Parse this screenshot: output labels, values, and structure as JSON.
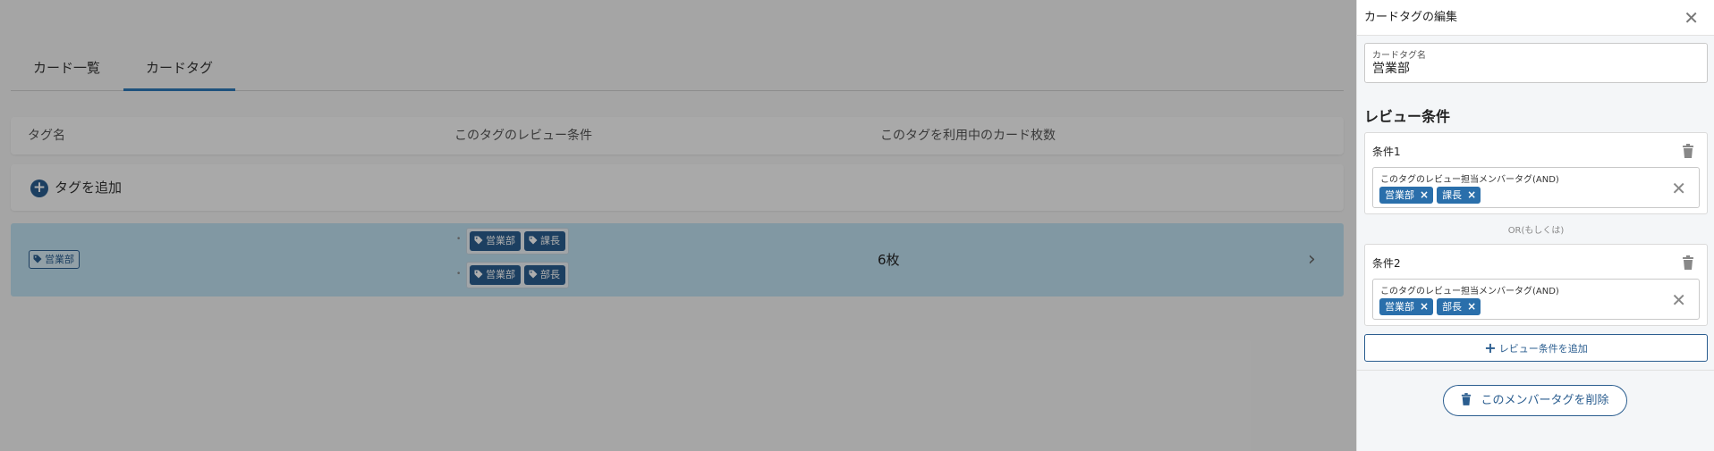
{
  "tabs": [
    {
      "label": "カード一覧"
    },
    {
      "label": "カードタグ"
    }
  ],
  "table": {
    "headers": [
      "タグ名",
      "このタグのレビュー条件",
      "このタグを利用中のカード枚数"
    ],
    "add_label": "タグを追加",
    "row": {
      "tag": "営業部",
      "conditions": [
        [
          "営業部",
          "課長"
        ],
        [
          "営業部",
          "部長"
        ]
      ],
      "count": "6枚"
    }
  },
  "panel": {
    "title": "カードタグの編集",
    "name_label": "カードタグ名",
    "name_value": "営業部",
    "section_title": "レビュー条件",
    "conditions": [
      {
        "title": "条件1",
        "member_label": "このタグのレビュー担当メンバータグ(AND)",
        "chips": [
          "営業部",
          "課長"
        ]
      },
      {
        "title": "条件2",
        "member_label": "このタグのレビュー担当メンバータグ(AND)",
        "chips": [
          "営業部",
          "部長"
        ]
      }
    ],
    "or_text": "OR(もしくは)",
    "add_condition_label": "レビュー条件を追加",
    "delete_label": "このメンバータグを削除"
  },
  "colors": {
    "accent": "#2a5d8f",
    "chip": "#2a6fab",
    "selected_row": "#bfe0f1"
  }
}
